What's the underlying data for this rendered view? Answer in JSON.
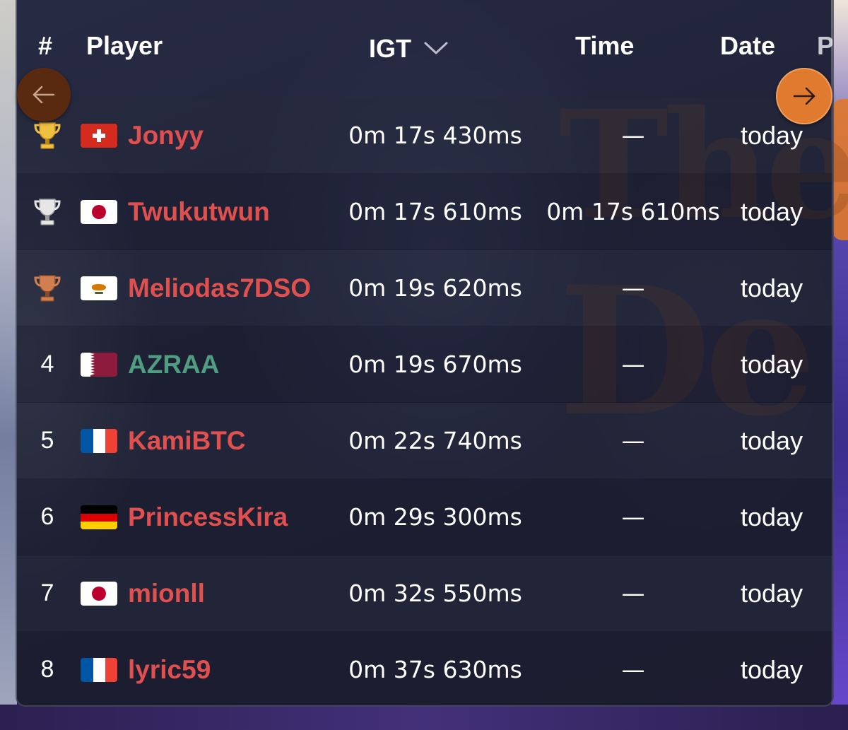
{
  "header": {
    "rank": "#",
    "player": "Player",
    "igt": "IGT",
    "time": "Time",
    "date": "Date",
    "extra": "P"
  },
  "icons": {
    "sort": "chevron-down-icon",
    "prev": "arrow-left-icon",
    "next": "arrow-right-icon",
    "gold": "trophy-gold-icon",
    "silver": "trophy-silver-icon",
    "bronze": "trophy-bronze-icon"
  },
  "colors": {
    "player_name": "#e0504e",
    "player_name_alt": "#4f9e82",
    "next_button": "#e07a2e",
    "prev_button": "#5a2a10"
  },
  "rows": [
    {
      "rank": "",
      "medal": "gold",
      "flag": "ch",
      "player": "Jonyy",
      "igt": "0m 17s 430ms",
      "time": "—",
      "date": "today"
    },
    {
      "rank": "",
      "medal": "silver",
      "flag": "jp",
      "player": "Twukutwun",
      "igt": "0m 17s 610ms",
      "time": "0m 17s 610ms",
      "date": "today"
    },
    {
      "rank": "",
      "medal": "bronze",
      "flag": "cy",
      "player": "Meliodas7DSO",
      "igt": "0m 19s 620ms",
      "time": "—",
      "date": "today"
    },
    {
      "rank": "4",
      "medal": "",
      "flag": "qa",
      "player": "AZRAA",
      "igt": "0m 19s 670ms",
      "time": "—",
      "date": "today"
    },
    {
      "rank": "5",
      "medal": "",
      "flag": "fr",
      "player": "KamiBTC",
      "igt": "0m 22s 740ms",
      "time": "—",
      "date": "today"
    },
    {
      "rank": "6",
      "medal": "",
      "flag": "de",
      "player": "PrincessKira",
      "igt": "0m 29s 300ms",
      "time": "—",
      "date": "today"
    },
    {
      "rank": "7",
      "medal": "",
      "flag": "jp",
      "player": "mionll",
      "igt": "0m 32s 550ms",
      "time": "—",
      "date": "today"
    },
    {
      "rank": "8",
      "medal": "",
      "flag": "fr",
      "player": "lyric59",
      "igt": "0m 37s 630ms",
      "time": "—",
      "date": "today"
    }
  ]
}
